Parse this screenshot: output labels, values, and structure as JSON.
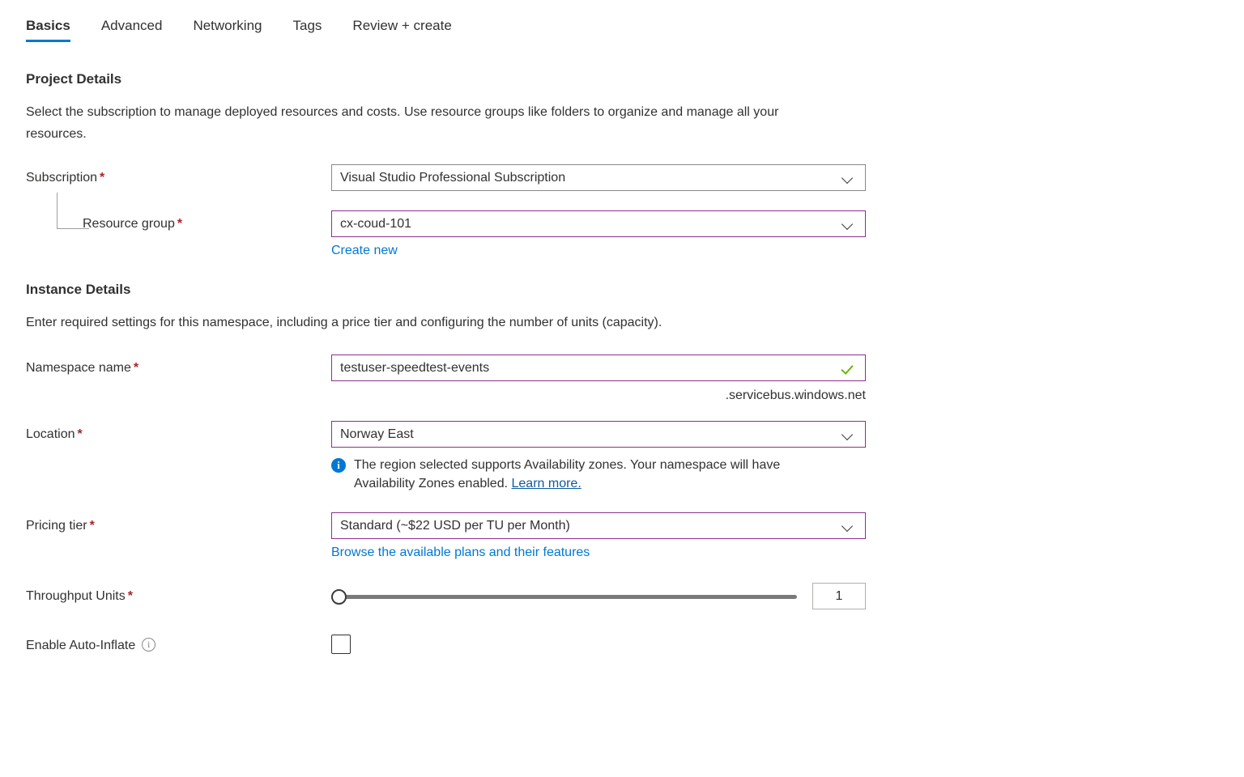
{
  "tabs": [
    {
      "label": "Basics",
      "active": true
    },
    {
      "label": "Advanced",
      "active": false
    },
    {
      "label": "Networking",
      "active": false
    },
    {
      "label": "Tags",
      "active": false
    },
    {
      "label": "Review + create",
      "active": false
    }
  ],
  "project_details": {
    "heading": "Project Details",
    "description": "Select the subscription to manage deployed resources and costs. Use resource groups like folders to organize and manage all your resources.",
    "subscription": {
      "label": "Subscription",
      "required": "*",
      "value": "Visual Studio Professional Subscription"
    },
    "resource_group": {
      "label": "Resource group",
      "required": "*",
      "value": "cx-coud-101",
      "create_new_link": "Create new"
    }
  },
  "instance_details": {
    "heading": "Instance Details",
    "description": "Enter required settings for this namespace, including a price tier and configuring the number of units (capacity).",
    "namespace_name": {
      "label": "Namespace name",
      "required": "*",
      "value": "testuser-speedtest-events",
      "suffix": ".servicebus.windows.net"
    },
    "location": {
      "label": "Location",
      "required": "*",
      "value": "Norway East",
      "info_text": "The region selected supports Availability zones. Your namespace will have Availability Zones enabled. ",
      "info_link": "Learn more."
    },
    "pricing_tier": {
      "label": "Pricing tier",
      "required": "*",
      "value": "Standard (~$22 USD per TU per Month)",
      "browse_link": "Browse the available plans and their features"
    },
    "throughput_units": {
      "label": "Throughput Units",
      "required": "*",
      "value": "1"
    },
    "auto_inflate": {
      "label": "Enable Auto-Inflate",
      "checked": false
    }
  },
  "colors": {
    "accent": "#0078d4",
    "required": "#a4262c",
    "focus_border": "#8c2f8c",
    "valid_check": "#6bb700",
    "neutral_border": "#8a8886"
  }
}
